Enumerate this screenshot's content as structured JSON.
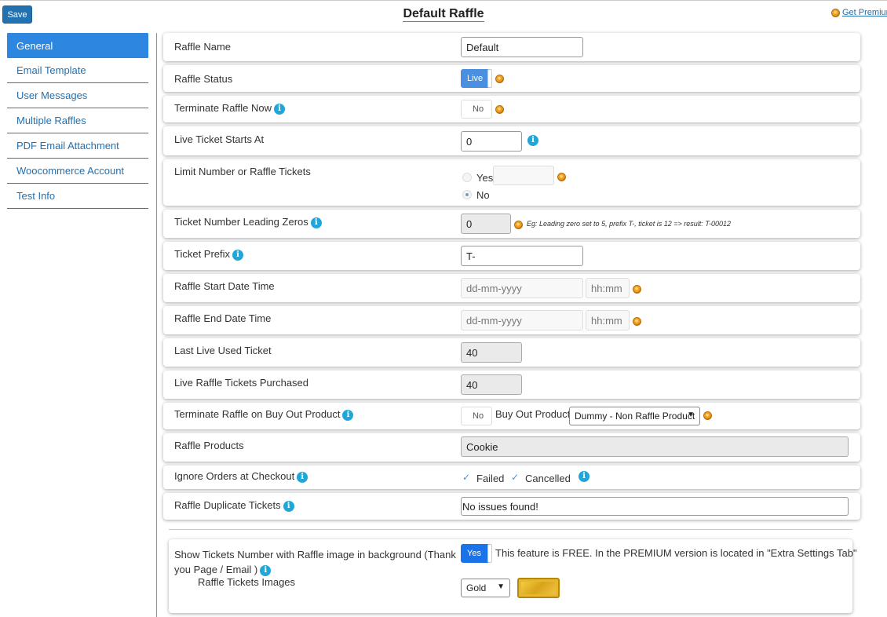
{
  "header": {
    "save_label": "Save",
    "title": "Default Raffle",
    "premium_link": "Get Premium"
  },
  "sidebar": {
    "items": [
      {
        "label": "General"
      },
      {
        "label": "Email Template"
      },
      {
        "label": "User Messages"
      },
      {
        "label": "Multiple Raffles"
      },
      {
        "label": "PDF Email Attachment"
      },
      {
        "label": "Woocommerce Account"
      },
      {
        "label": "Test Info"
      }
    ]
  },
  "form": {
    "raffle_name": {
      "label": "Raffle Name",
      "value": "Default"
    },
    "raffle_status": {
      "label": "Raffle Status",
      "value": "Live"
    },
    "terminate_now": {
      "label": "Terminate Raffle Now",
      "value": "No"
    },
    "live_ticket_start": {
      "label": "Live Ticket Starts At",
      "value": "0"
    },
    "limit_tickets": {
      "label": "Limit Number or Raffle Tickets",
      "yes": "Yes",
      "no": "No"
    },
    "leading_zeros": {
      "label": "Ticket Number Leading Zeros",
      "value": "0",
      "note": "Eg: Leading zero set to 5, prefix T-, ticket is 12 => result: T-00012"
    },
    "ticket_prefix": {
      "label": "Ticket Prefix",
      "value": "T-"
    },
    "start_datetime": {
      "label": "Raffle Start Date Time",
      "date_placeholder": "dd-mm-yyyy",
      "time_placeholder": "hh:mm"
    },
    "end_datetime": {
      "label": "Raffle End Date Time",
      "date_placeholder": "dd-mm-yyyy",
      "time_placeholder": "hh:mm"
    },
    "last_live_ticket": {
      "label": "Last Live Used Ticket",
      "value": "40"
    },
    "tickets_purchased": {
      "label": "Live Raffle Tickets Purchased",
      "value": "40"
    },
    "terminate_buyout": {
      "label": "Terminate Raffle on Buy Out Product",
      "value": "No",
      "buyout_label": "Buy Out Product",
      "buyout_selected": "Dummy - Non Raffle Product"
    },
    "raffle_products": {
      "label": "Raffle Products",
      "value": "Cookie"
    },
    "ignore_orders": {
      "label": "Ignore Orders at Checkout",
      "failed": "Failed",
      "cancelled": "Cancelled"
    },
    "duplicate_tickets": {
      "label": "Raffle Duplicate Tickets",
      "value": "No issues found!"
    },
    "show_tickets": {
      "label_line1": "Show Tickets Number with Raffle image in background (Thank",
      "label_line2": "you Page / Email )",
      "value": "Yes",
      "note": "This feature is FREE. In the PREMIUM version is located in \"Extra Settings Tab\"",
      "images_label": "Raffle Tickets Images",
      "image_selected": "Gold"
    }
  }
}
